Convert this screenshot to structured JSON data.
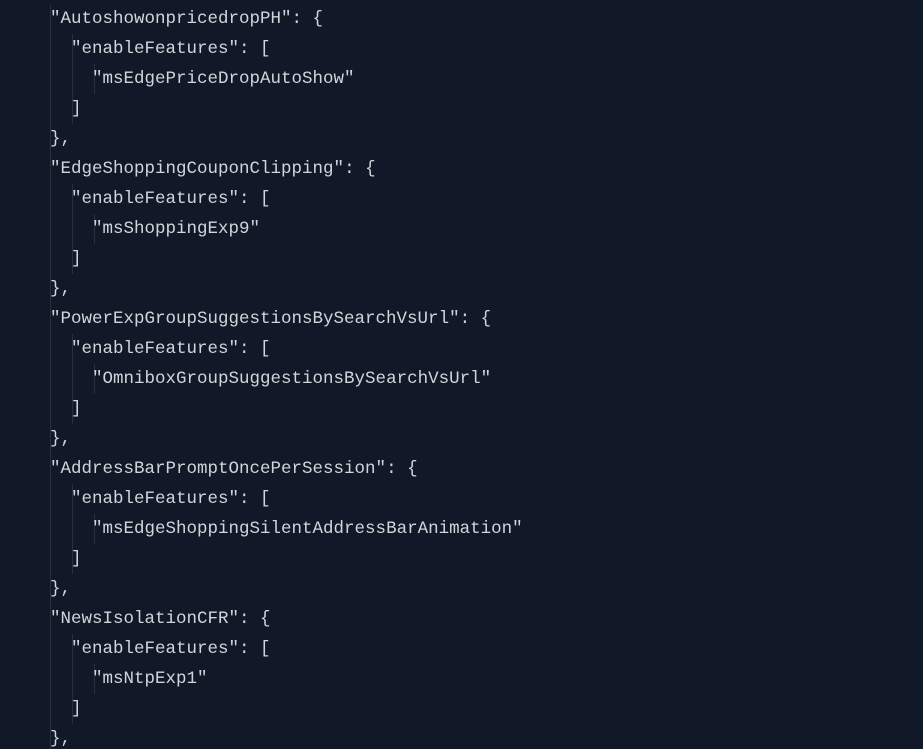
{
  "code": {
    "entries": [
      {
        "key": "\"AutoshowonpricedropPH\"",
        "innerKey": "\"enableFeatures\"",
        "value": "\"msEdgePriceDropAutoShow\""
      },
      {
        "key": "\"EdgeShoppingCouponClipping\"",
        "innerKey": "\"enableFeatures\"",
        "value": "\"msShoppingExp9\""
      },
      {
        "key": "\"PowerExpGroupSuggestionsBySearchVsUrl\"",
        "innerKey": "\"enableFeatures\"",
        "value": "\"OmniboxGroupSuggestionsBySearchVsUrl\""
      },
      {
        "key": "\"AddressBarPromptOncePerSession\"",
        "innerKey": "\"enableFeatures\"",
        "value": "\"msEdgeShoppingSilentAddressBarAnimation\""
      },
      {
        "key": "\"NewsIsolationCFR\"",
        "innerKey": "\"enableFeatures\"",
        "value": "\"msNtpExp1\""
      }
    ],
    "punct": {
      "openObj": ": {",
      "openArr": ": [",
      "closeArr": "]",
      "closeObjComma": "},"
    }
  }
}
